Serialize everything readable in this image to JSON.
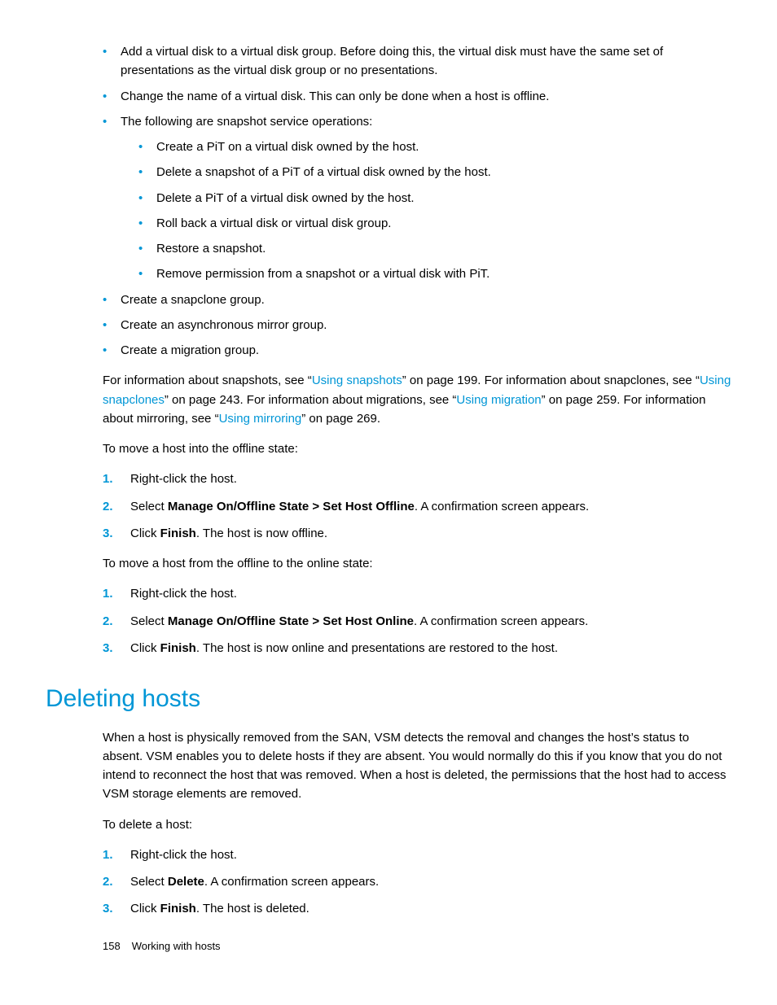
{
  "bullets_top": [
    "Add a virtual disk to a virtual disk group. Before doing this, the virtual disk must have the same set of presentations as the virtual disk group or no presentations.",
    "Change the name of a virtual disk. This can only be done when a host is offline.",
    "The following are snapshot service operations:",
    "Create a snapclone group.",
    "Create an asynchronous mirror group.",
    "Create a migration group."
  ],
  "sub_bullets": [
    "Create a PiT on a virtual disk owned by the host.",
    "Delete a snapshot of a PiT of a virtual disk owned by the host.",
    "Delete a PiT of a virtual disk owned by the host.",
    "Roll back a virtual disk or virtual disk group.",
    "Restore a snapshot.",
    "Remove permission from a snapshot or a virtual disk with PiT."
  ],
  "info_para": {
    "p1a": "For information about snapshots, see “",
    "link1": "Using snapshots",
    "p1b": "” on page 199. For information about snapclones, see “",
    "link2": "Using snapclones",
    "p1c": "” on page 243. For information about migrations, see “",
    "link3": "Using migration",
    "p1d": "” on page 259. For information about mirroring, see “",
    "link4": "Using mirroring",
    "p1e": "” on page 269."
  },
  "offline_intro": "To move a host into the offline state:",
  "offline_steps": {
    "s1": "Right-click the host.",
    "s2a": "Select ",
    "s2bold": "Manage On/Offline State > Set Host Offline",
    "s2b": ". A confirmation screen appears.",
    "s3a": "Click ",
    "s3bold": "Finish",
    "s3b": ". The host is now offline."
  },
  "online_intro": "To move a host from the offline to the online state:",
  "online_steps": {
    "s1": "Right-click the host.",
    "s2a": "Select ",
    "s2bold": "Manage On/Offline State > Set Host Online",
    "s2b": ". A confirmation screen appears.",
    "s3a": "Click ",
    "s3bold": "Finish",
    "s3b": ". The host is now online and presentations are restored to the host."
  },
  "heading": "Deleting hosts",
  "deleting_para": "When a host is physically removed from the SAN, VSM detects the removal and changes the host’s status to absent. VSM enables you to delete hosts if they are absent. You would normally do this if you know that you do not intend to reconnect the host that was removed. When a host is deleted, the permissions that the host had to access VSM storage elements are removed.",
  "delete_intro": "To delete a host:",
  "delete_steps": {
    "s1": "Right-click the host.",
    "s2a": "Select ",
    "s2bold": "Delete",
    "s2b": ". A confirmation screen appears.",
    "s3a": "Click ",
    "s3bold": "Finish",
    "s3b": ". The host is deleted."
  },
  "footer": {
    "page": "158",
    "title": "Working with hosts"
  }
}
